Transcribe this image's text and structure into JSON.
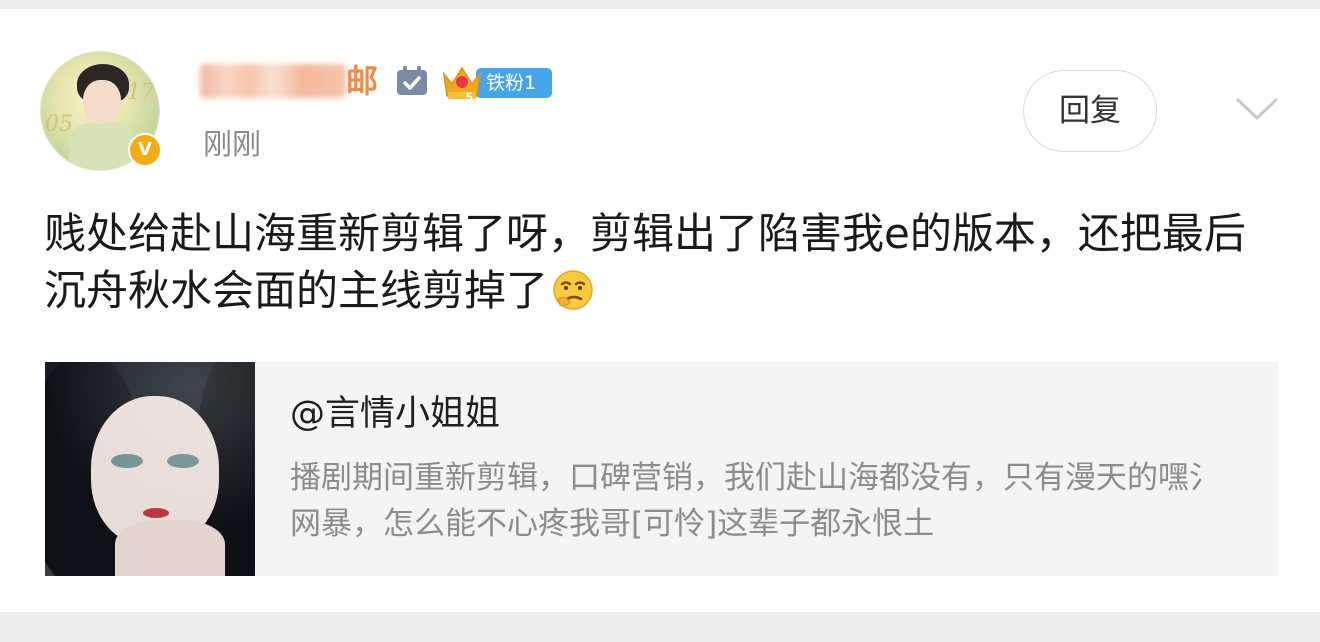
{
  "post": {
    "username_visible_tail": "邮",
    "fan_badge_label": "铁粉1",
    "fan_level_digit": "5",
    "time": "刚刚",
    "reply_label": "回复",
    "text": "贱处给赴山海重新剪辑了呀，剪辑出了陷害我e的版本，还把最后沉舟秋水会面的主线剪掉了",
    "avatar_numbers": [
      "05",
      "17"
    ],
    "verified_mark": "V"
  },
  "quote": {
    "name": "@言情小姐姐",
    "text": "播剧期间重新剪辑，口碑营销，我们赴山海都没有，只有漫天的嘿氵网暴，怎么能不心疼我哥[可怜]这辈子都永恨土"
  },
  "colors": {
    "username": "#f28a48",
    "fan_pill": "#46a5e8",
    "verified": "#f3ad12",
    "time": "#8a8a8a",
    "quote_text": "#8c8c8c"
  },
  "icons": [
    "avatar",
    "verified-v-icon",
    "calendar-check-icon",
    "crown-icon",
    "chevron-down-icon",
    "thinking-face-emoji"
  ]
}
